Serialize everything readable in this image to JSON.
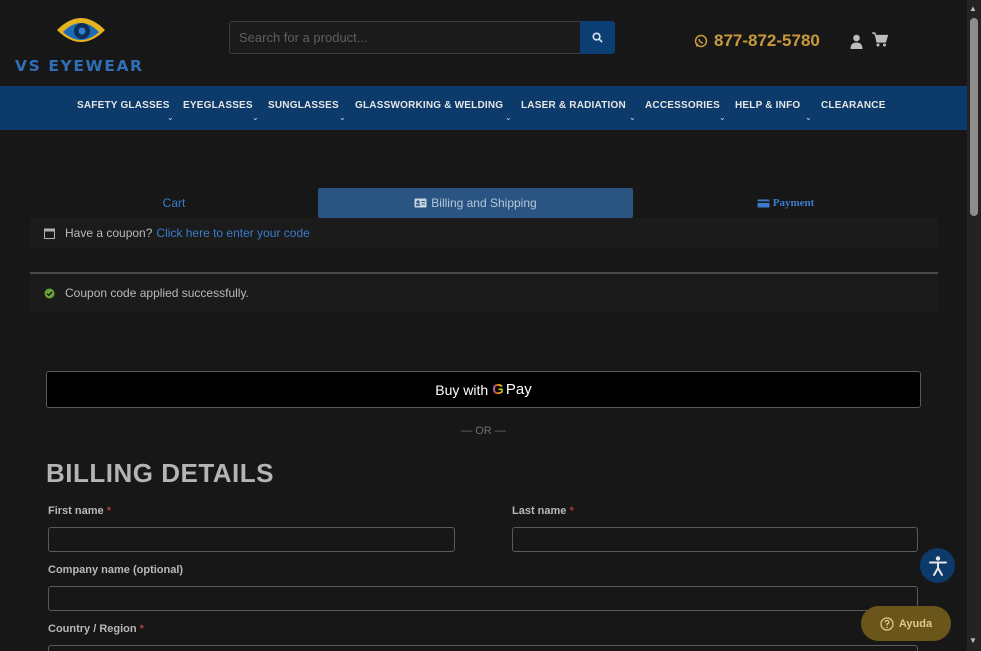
{
  "header": {
    "logo_text": "VS EYEWEAR",
    "search_placeholder": "Search for a product...",
    "phone": "877-872-5780"
  },
  "nav": {
    "items": [
      {
        "label": "SAFETY GLASSES",
        "has_dropdown": true
      },
      {
        "label": "EYEGLASSES",
        "has_dropdown": true
      },
      {
        "label": "SUNGLASSES",
        "has_dropdown": true
      },
      {
        "label": "GLASSWORKING & WELDING",
        "has_dropdown": true
      },
      {
        "label": "LASER & RADIATION",
        "has_dropdown": true
      },
      {
        "label": "ACCESSORIES",
        "has_dropdown": true
      },
      {
        "label": "HELP & INFO",
        "has_dropdown": true
      },
      {
        "label": "CLEARANCE",
        "has_dropdown": false
      }
    ]
  },
  "checkout_steps": {
    "cart": "Cart",
    "billing": "Billing and Shipping",
    "payment": "Payment",
    "active": "billing"
  },
  "notices": {
    "coupon_prompt": "Have a coupon?",
    "coupon_link": "Click here to enter your code",
    "success": "Coupon code applied successfully."
  },
  "gpay": {
    "prefix": "Buy with",
    "g": "G",
    "pay": "Pay"
  },
  "or_separator": "— OR —",
  "billing": {
    "title": "BILLING DETAILS",
    "first_name_label": "First name",
    "last_name_label": "Last name",
    "company_label": "Company name (optional)",
    "country_label": "Country / Region",
    "required_mark": "*"
  },
  "floating": {
    "help_label": "Ayuda"
  },
  "colors": {
    "background": "#171717",
    "nav_background": "#0c3a6a",
    "link": "#3a7cc9",
    "phone": "#c99a3c",
    "active_step": "#2a5582",
    "success": "#6aa23a"
  }
}
